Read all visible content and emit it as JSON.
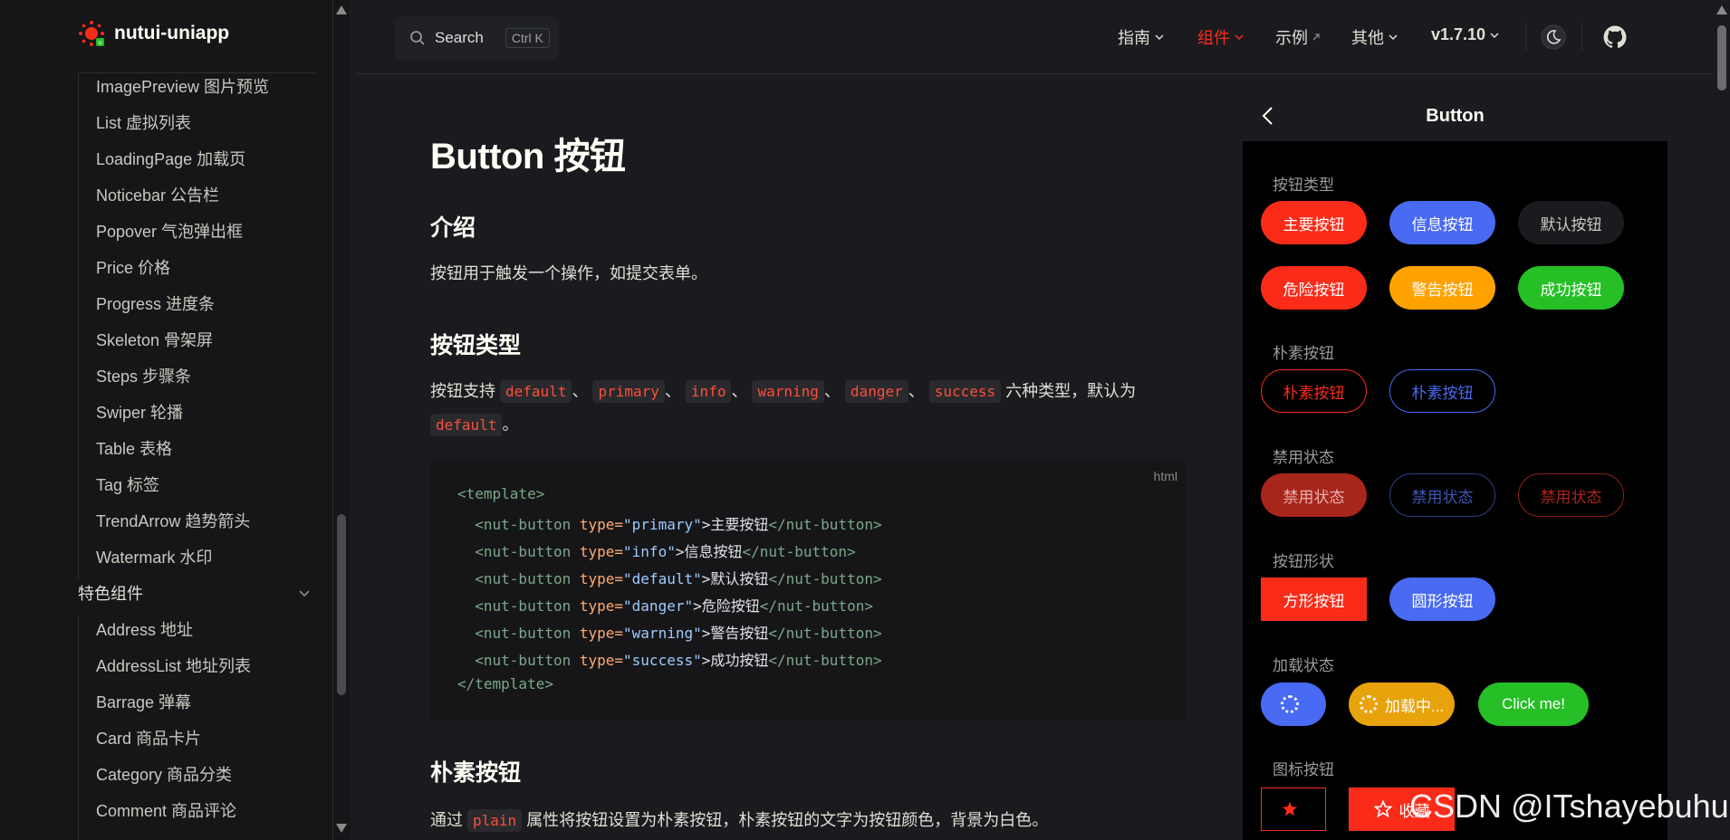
{
  "brand": {
    "name": "nutui-uniapp"
  },
  "sidebar": {
    "group1_items": [
      "ImagePreview 图片预览",
      "List 虚拟列表",
      "LoadingPage 加载页",
      "Noticebar 公告栏",
      "Popover 气泡弹出框",
      "Price 价格",
      "Progress 进度条",
      "Skeleton 骨架屏",
      "Steps 步骤条",
      "Swiper 轮播",
      "Table 表格",
      "Tag 标签",
      "TrendArrow 趋势箭头",
      "Watermark 水印"
    ],
    "group2_title": "特色组件",
    "group2_items": [
      "Address 地址",
      "AddressList 地址列表",
      "Barrage 弹幕",
      "Card 商品卡片",
      "Category 商品分类",
      "Comment 商品评论"
    ]
  },
  "topbar": {
    "search_label": "Search",
    "search_kbd": "Ctrl K",
    "nav": [
      {
        "label": "指南",
        "chevron": "chevron-down-icon"
      },
      {
        "label": "组件",
        "chevron": "chevron-down-icon",
        "active": true
      },
      {
        "label": "示例",
        "chevron": "external-link-icon"
      },
      {
        "label": "其他",
        "chevron": "chevron-down-icon"
      },
      {
        "label": "v1.7.10",
        "chevron": "chevron-down-icon"
      }
    ],
    "accent_color": "#fa2c19"
  },
  "content": {
    "title": "Button 按钮",
    "intro_heading": "介绍",
    "intro_text": "按钮用于触发一个操作，如提交表单。",
    "types_heading": "按钮类型",
    "types_text_prefix": "按钮支持",
    "types_codes": [
      "default",
      "primary",
      "info",
      "warning",
      "danger",
      "success"
    ],
    "separator": "、",
    "types_text_suffix": "六种类型，默认为",
    "types_default_code": "default",
    "types_end": "。",
    "code_lang": "html",
    "code_lines": [
      {
        "indent": "",
        "open": "<template>",
        "attr": "",
        "val": "",
        "text": "",
        "close": ""
      },
      {
        "indent": "  ",
        "open": "<nut-button",
        "attr": " type=",
        "val": "\"primary\"",
        "text": ">主要按钮",
        "close": "</nut-button>"
      },
      {
        "indent": "  ",
        "open": "<nut-button",
        "attr": " type=",
        "val": "\"info\"",
        "text": ">信息按钮",
        "close": "</nut-button>"
      },
      {
        "indent": "  ",
        "open": "<nut-button",
        "attr": " type=",
        "val": "\"default\"",
        "text": ">默认按钮",
        "close": "</nut-button>"
      },
      {
        "indent": "  ",
        "open": "<nut-button",
        "attr": " type=",
        "val": "\"danger\"",
        "text": ">危险按钮",
        "close": "</nut-button>"
      },
      {
        "indent": "  ",
        "open": "<nut-button",
        "attr": " type=",
        "val": "\"warning\"",
        "text": ">警告按钮",
        "close": "</nut-button>"
      },
      {
        "indent": "  ",
        "open": "<nut-button",
        "attr": " type=",
        "val": "\"success\"",
        "text": ">成功按钮",
        "close": "</nut-button>"
      },
      {
        "indent": "",
        "open": "</template>",
        "attr": "",
        "val": "",
        "text": "",
        "close": ""
      }
    ],
    "plain_heading": "朴素按钮",
    "plain_text_prefix": "通过",
    "plain_code": "plain",
    "plain_text_suffix": "属性将按钮设置为朴素按钮，朴素按钮的文字为按钮颜色，背景为白色。"
  },
  "phone": {
    "title": "Button",
    "sections": {
      "types": "按钮类型",
      "plain": "朴素按钮",
      "disabled": "禁用状态",
      "shape": "按钮形状",
      "loading": "加载状态",
      "icon": "图标按钮"
    },
    "type_buttons": [
      "主要按钮",
      "信息按钮",
      "默认按钮",
      "危险按钮",
      "警告按钮",
      "成功按钮"
    ],
    "plain_buttons": [
      "朴素按钮",
      "朴素按钮"
    ],
    "disabled_buttons": [
      "禁用状态",
      "禁用状态",
      "禁用状态"
    ],
    "shape_buttons": [
      "方形按钮",
      "圆形按钮"
    ],
    "loading_buttons": [
      "",
      "加载中...",
      "Click me!"
    ],
    "icon_buttons": [
      "",
      "收藏"
    ],
    "colors": {
      "primary": "#fa2c19",
      "info": "#496af2",
      "default": "#1b1b1f",
      "danger": "#fa2c19",
      "warning": "#ffa200",
      "success": "#26bf26"
    }
  },
  "watermark": "CSDN @ITshayebuhui"
}
